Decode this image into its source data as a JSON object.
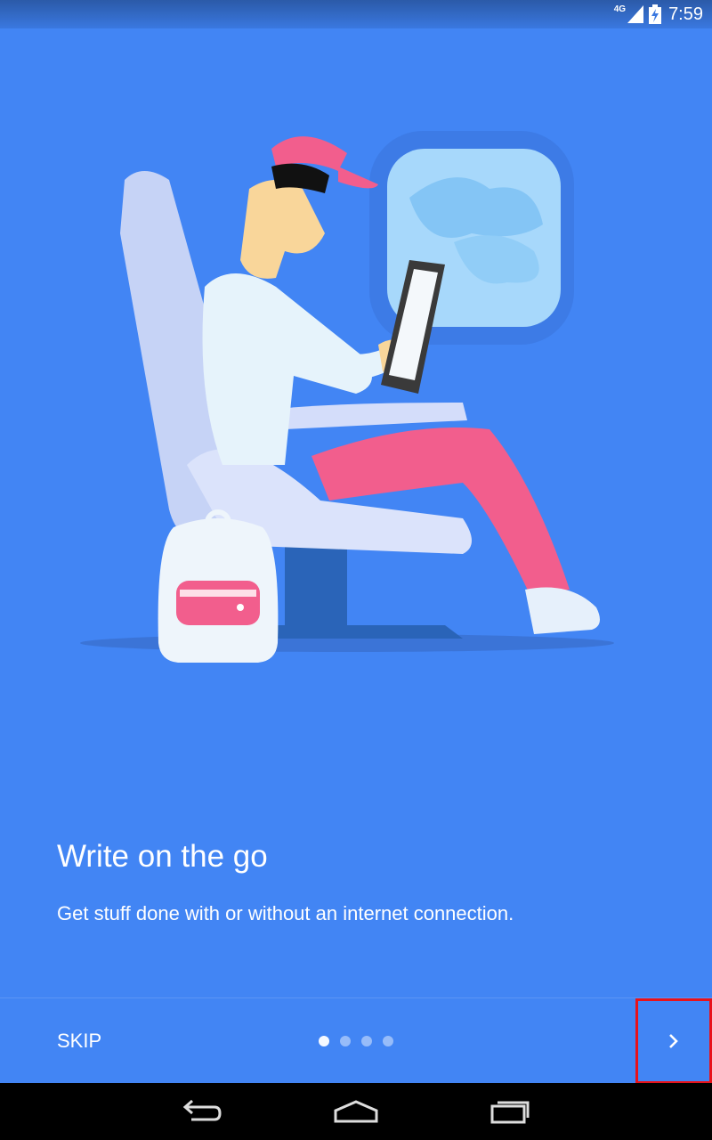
{
  "status_bar": {
    "network": "4G",
    "time": "7:59",
    "icons": [
      "signal-icon",
      "battery-icon"
    ]
  },
  "onboarding": {
    "title": "Write on the go",
    "subtitle": "Get stuff done with or without an internet connection.",
    "illustration": "traveler-on-plane-illustration"
  },
  "bottom_bar": {
    "skip_label": "SKIP",
    "page_count": 4,
    "current_page": 1,
    "next_icon": "chevron-right-icon"
  },
  "nav_bar": {
    "icons": [
      "back-icon",
      "home-icon",
      "recents-icon"
    ]
  },
  "colors": {
    "background": "#4285f4",
    "highlight": "#e8121a"
  }
}
